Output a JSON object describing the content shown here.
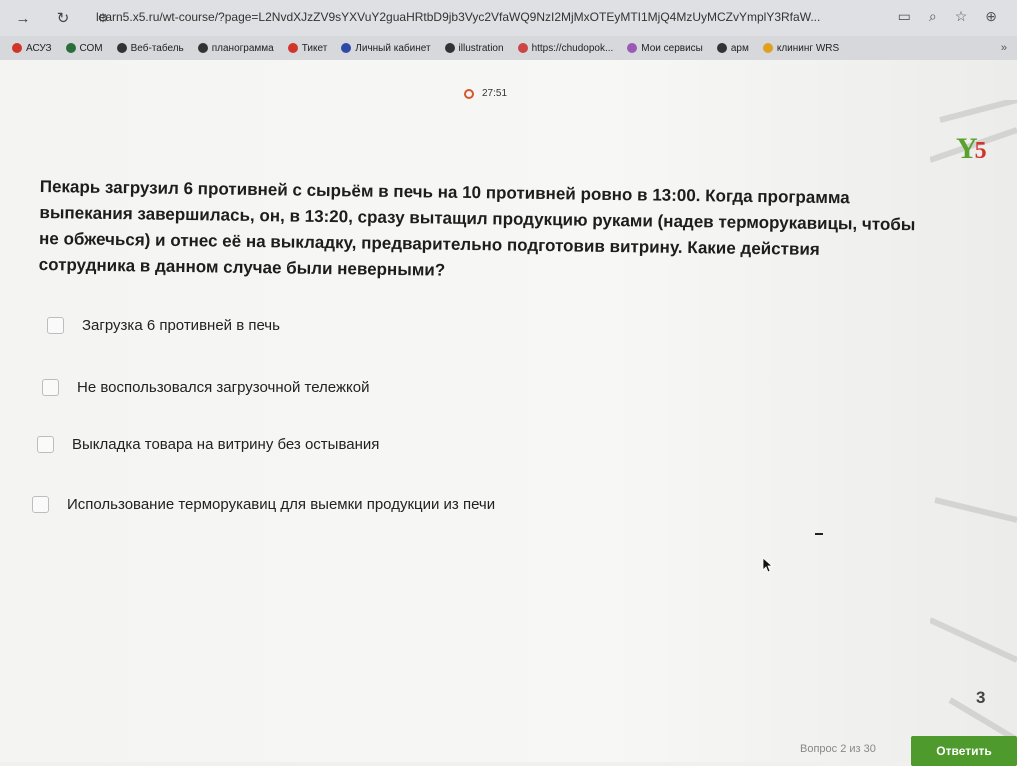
{
  "browser": {
    "url": "learn5.x5.ru/wt-course/?page=L2NvdXJzZV9sYXVuY2guaHRtbD9jb3Vyc2VfaWQ9NzI2MjMxOTEyMTI1MjQ4MzUyMCZvYmplY3RfaW...",
    "bookmarks": [
      {
        "label": "АСУЗ",
        "color": "#d0342c"
      },
      {
        "label": "СОМ",
        "color": "#2c6e3a"
      },
      {
        "label": "Веб-табель",
        "color": "#333333"
      },
      {
        "label": "планограмма",
        "color": "#333333"
      },
      {
        "label": "Тикет",
        "color": "#d0342c"
      },
      {
        "label": "Личный кабинет",
        "color": "#2c4aa6"
      },
      {
        "label": "illustration",
        "color": "#333333"
      },
      {
        "label": "https://chudopok...",
        "color": "#c44"
      },
      {
        "label": "Мои сервисы",
        "color": "#9b59b6"
      },
      {
        "label": "арм",
        "color": "#333333"
      },
      {
        "label": "клининг WRS",
        "color": "#e0a020"
      }
    ],
    "more": "»"
  },
  "quiz": {
    "timer": "27:51",
    "question": "Пекарь загрузил 6 противней с сырьём в печь на 10 противней ровно в 13:00. Когда программа выпекания завершилась, он, в 13:20, сразу вытащил продукцию руками (надев терморукавицы, чтобы не обжечься) и отнес её на выкладку, предварительно подготовив витрину. Какие действия сотрудника в данном случае были неверными?",
    "options": [
      "Загрузка 6 противней в печь",
      "Не воспользовался загрузочной тележкой",
      "Выкладка товара на витрину без остывания",
      "Использование терморукавиц для выемки продукции из печи"
    ],
    "page_number": "3",
    "progress": "Вопрос 2 из 30",
    "submit_label": "Ответить"
  },
  "colors": {
    "accent": "#4e9a2c",
    "timer": "#d9552b",
    "logo_green": "#5aa22e",
    "logo_red": "#d0342c"
  }
}
